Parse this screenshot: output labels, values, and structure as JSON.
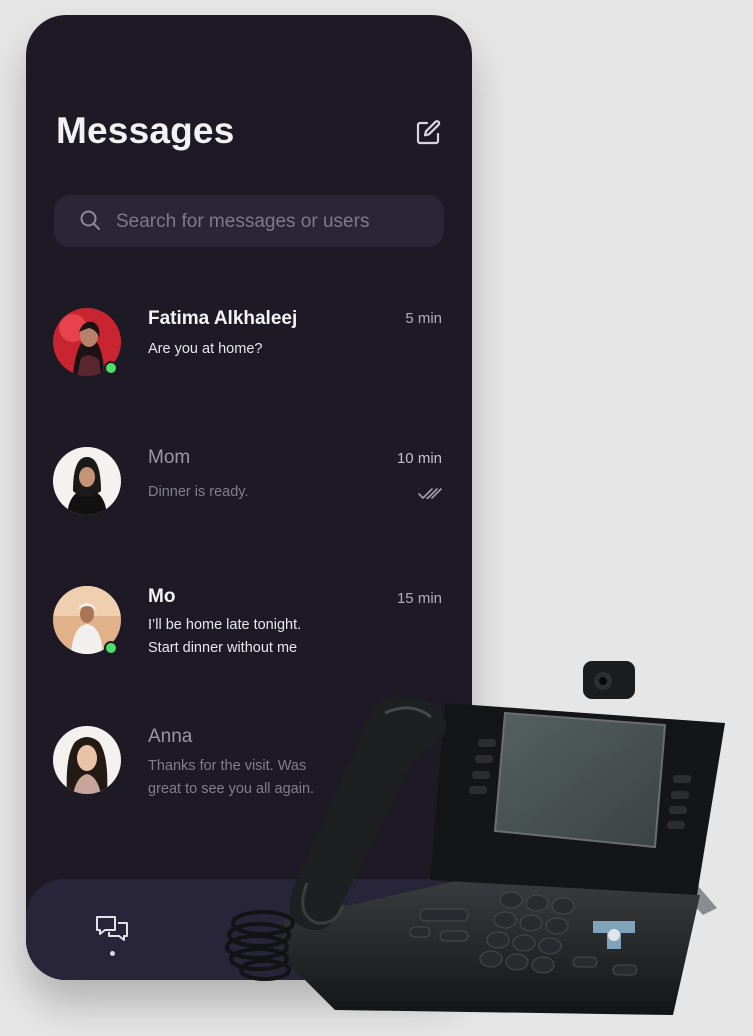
{
  "header": {
    "title": "Messages",
    "compose_icon": "compose-icon"
  },
  "search": {
    "placeholder": "Search for messages or users",
    "icon": "search-icon"
  },
  "conversations": [
    {
      "name": "Fatima Alkhaleej",
      "preview": "Are you at home?",
      "time": "5 min",
      "unread": true,
      "online": true
    },
    {
      "name": "Mom",
      "preview": "Dinner is ready.",
      "time": "10 min",
      "unread": false,
      "online": false,
      "read_receipt": "double-check-icon"
    },
    {
      "name": "Mo",
      "preview": "I’ll be home late tonight. Start dinner without me",
      "time": "15 min",
      "unread": true,
      "online": true
    },
    {
      "name": "Anna",
      "preview": "Thanks for the visit. Was great to see you all again.",
      "time": "",
      "unread": false,
      "online": false
    }
  ],
  "tabbar": {
    "active_tab_icon": "chat-bubbles-icon"
  },
  "colors": {
    "background": "#1d1a26",
    "search_bg": "#2a2637",
    "tabbar_bg": "#28243a",
    "online": "#4ddf6a"
  }
}
